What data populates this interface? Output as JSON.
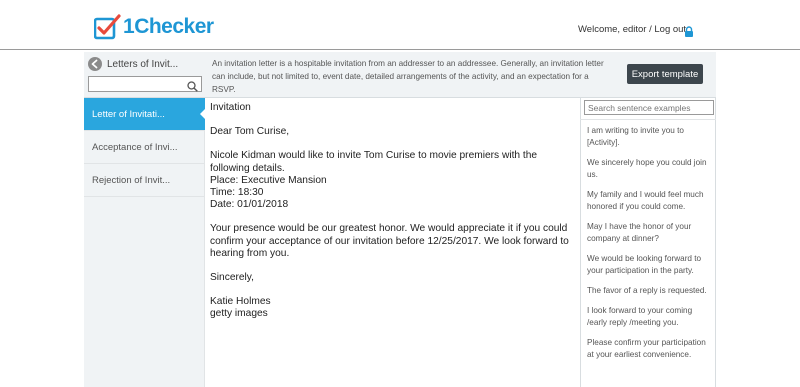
{
  "header": {
    "logo_text_1": "1",
    "logo_text_2": "Checker",
    "welcome_text": "Welcome, editor / Log out",
    "logo_icon": "checkbox-logo-icon",
    "lock_icon": "lock-icon",
    "brand_color": "#1e96d4",
    "logo_accent": "#e84a3c"
  },
  "category": {
    "title": "Letters of Invit...",
    "back_icon": "back-arrow-icon",
    "search_value": "",
    "search_icon": "search-icon"
  },
  "description": "An invitation letter is a hospitable invitation from an addresser to an addressee. Generally, an invitation letter can include, but not limited to, event date, detailed arrangements of the activity, and an expectation for a RSVP.",
  "export_label": "Export template",
  "sidebar": {
    "items": [
      {
        "label": "Letter of Invitati...",
        "active": true
      },
      {
        "label": "Acceptance of Invi...",
        "active": false
      },
      {
        "label": "Rejection of Invit...",
        "active": false
      }
    ],
    "active_color": "#2aa6de"
  },
  "letter": {
    "title": "Invitation",
    "greeting": "Dear Tom Curise,",
    "body_line": "Nicole Kidman would like to invite Tom Curise to movie premiers with the following details.",
    "place": "Place: Executive Mansion",
    "time": "Time: 18:30",
    "date": "Date: 01/01/2018",
    "closing_para": "Your presence would be our greatest honor. We would appreciate it if you could confirm your acceptance of our invitation before 12/25/2017. We look forward to hearing from you.",
    "signoff": "Sincerely,",
    "name": "Katie Holmes",
    "company": "getty images"
  },
  "examples": {
    "search_placeholder": "Search sentence examples",
    "items": [
      "I am writing to invite you to [Activity].",
      "We sincerely hope you could join us.",
      "My family and I would feel much honored if you could come.",
      "May I have the honor of your company at dinner?",
      "We would be looking forward to your participation in the party.",
      "The favor of a reply is requested.",
      "I look forward to your coming /early reply /meeting you.",
      "Please confirm your participation at your earliest convenience."
    ]
  }
}
